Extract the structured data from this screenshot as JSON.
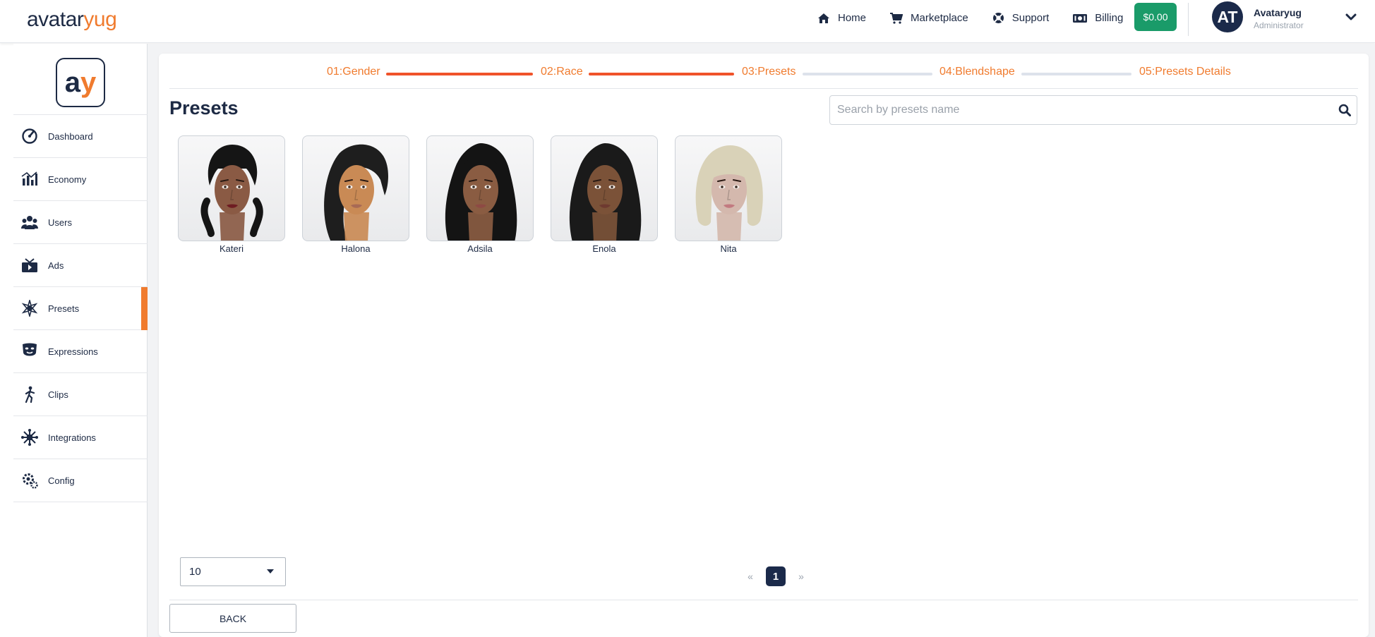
{
  "brand": {
    "logo_part1": "avatar",
    "logo_part2": "yug",
    "side_logo_a": "a",
    "side_logo_y": "y"
  },
  "topnav": {
    "items": [
      {
        "label": "Home",
        "icon": "home-icon"
      },
      {
        "label": "Marketplace",
        "icon": "cart-icon"
      },
      {
        "label": "Support",
        "icon": "support-icon"
      },
      {
        "label": "Billing",
        "icon": "billing-icon"
      }
    ],
    "balance": "$0.00"
  },
  "user": {
    "initials": "AT",
    "name": "Avataryug",
    "role": "Administrator"
  },
  "sidebar": {
    "items": [
      {
        "label": "Dashboard",
        "icon": "dashboard-icon"
      },
      {
        "label": "Economy",
        "icon": "economy-icon"
      },
      {
        "label": "Users",
        "icon": "users-icon"
      },
      {
        "label": "Ads",
        "icon": "ads-icon"
      },
      {
        "label": "Presets",
        "icon": "presets-icon",
        "active": true
      },
      {
        "label": "Expressions",
        "icon": "expressions-icon"
      },
      {
        "label": "Clips",
        "icon": "clips-icon"
      },
      {
        "label": "Integrations",
        "icon": "integrations-icon"
      },
      {
        "label": "Config",
        "icon": "config-icon"
      }
    ]
  },
  "steps": [
    {
      "label": "01:Gender",
      "done": true
    },
    {
      "label": "02:Race",
      "done": true
    },
    {
      "label": "03:Presets",
      "done": false
    },
    {
      "label": "04:Blendshape",
      "done": false
    },
    {
      "label": "05:Presets Details",
      "done": false
    }
  ],
  "page": {
    "title": "Presets"
  },
  "search": {
    "placeholder": "Search by presets name",
    "value": ""
  },
  "presets": [
    {
      "name": "Kateri",
      "skin": "#8a5a44",
      "hair": "#151515",
      "hairstyle": "short",
      "lips": "#6e1c22"
    },
    {
      "name": "Halona",
      "skin": "#c98a55",
      "hair": "#1e1e1e",
      "hairstyle": "side",
      "lips": "#a86a55"
    },
    {
      "name": "Adsila",
      "skin": "#8a5c42",
      "hair": "#141414",
      "hairstyle": "long",
      "lips": "#8e4a44"
    },
    {
      "name": "Enola",
      "skin": "#7b5238",
      "hair": "#1a1a1a",
      "hairstyle": "long",
      "lips": "#6e3a30"
    },
    {
      "name": "Nita",
      "skin": "#d4b8ad",
      "hair": "#d9d2b8",
      "hairstyle": "bob",
      "lips": "#c27a80"
    }
  ],
  "pagination": {
    "per_page": "10",
    "prev": "«",
    "current": "1",
    "next": "»"
  },
  "footer": {
    "back_label": "BACK"
  },
  "colors": {
    "accent": "#f07b2e",
    "step_done": "#f0532a",
    "navy": "#1b2a4a",
    "balance": "#1a9b69"
  }
}
